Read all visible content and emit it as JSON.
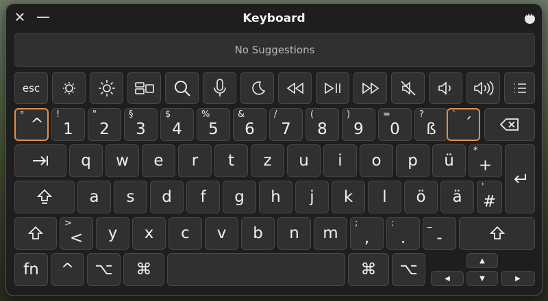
{
  "window": {
    "title": "Keyboard",
    "close_glyph": "✕",
    "minimize_glyph": "—"
  },
  "suggestions": {
    "text": "No Suggestions"
  },
  "function_row": [
    {
      "id": "esc",
      "label": "esc",
      "icon": ""
    },
    {
      "id": "brightness-down",
      "label": "",
      "icon": "brightness-down-icon"
    },
    {
      "id": "brightness-up",
      "label": "",
      "icon": "brightness-up-icon"
    },
    {
      "id": "mission-control",
      "label": "",
      "icon": "mission-control-icon"
    },
    {
      "id": "search",
      "label": "",
      "icon": "search-icon"
    },
    {
      "id": "dictation",
      "label": "",
      "icon": "microphone-icon"
    },
    {
      "id": "focus",
      "label": "",
      "icon": "moon-icon"
    },
    {
      "id": "rewind",
      "label": "",
      "icon": "rewind-icon"
    },
    {
      "id": "play-pause",
      "label": "",
      "icon": "play-pause-icon"
    },
    {
      "id": "fast-forward",
      "label": "",
      "icon": "fast-forward-icon"
    },
    {
      "id": "mute",
      "label": "",
      "icon": "mute-icon"
    },
    {
      "id": "volume-down",
      "label": "",
      "icon": "volume-down-icon"
    },
    {
      "id": "volume-up",
      "label": "",
      "icon": "volume-up-icon"
    },
    {
      "id": "list",
      "label": "",
      "icon": "list-icon"
    }
  ],
  "number_row": [
    {
      "main": "^",
      "sup": "°"
    },
    {
      "main": "1",
      "sup": "!"
    },
    {
      "main": "2",
      "sup": "\""
    },
    {
      "main": "3",
      "sup": "§"
    },
    {
      "main": "4",
      "sup": "$"
    },
    {
      "main": "5",
      "sup": "%"
    },
    {
      "main": "6",
      "sup": "&"
    },
    {
      "main": "7",
      "sup": "/"
    },
    {
      "main": "8",
      "sup": "("
    },
    {
      "main": "9",
      "sup": ")"
    },
    {
      "main": "0",
      "sup": "="
    },
    {
      "main": "ß",
      "sup": "?"
    },
    {
      "main": "´",
      "sup": "`"
    }
  ],
  "qwertz_row": [
    "q",
    "w",
    "e",
    "r",
    "t",
    "z",
    "u",
    "i",
    "o",
    "p",
    "ü"
  ],
  "plus_key": {
    "main": "+",
    "sup": "*"
  },
  "home_row": [
    "a",
    "s",
    "d",
    "f",
    "g",
    "h",
    "j",
    "k",
    "l",
    "ö",
    "ä"
  ],
  "hash_key": {
    "main": "#",
    "sup": "'"
  },
  "bottom_letters": [
    "y",
    "x",
    "c",
    "v",
    "b",
    "n",
    "m"
  ],
  "lt_key": {
    "main": "<",
    "sup": ">"
  },
  "comma_key": {
    "main": ",",
    "sup": ";"
  },
  "period_key": {
    "main": ".",
    "sup": ":"
  },
  "minus_key": {
    "main": "-",
    "sup": "_"
  },
  "modifiers": {
    "fn": "fn",
    "control": "^",
    "option": "⌥",
    "command": "⌘"
  },
  "arrows": {
    "up": "▲",
    "down": "▼",
    "left": "◀",
    "right": "▶"
  },
  "highlighted_keys": [
    "^",
    "´"
  ]
}
